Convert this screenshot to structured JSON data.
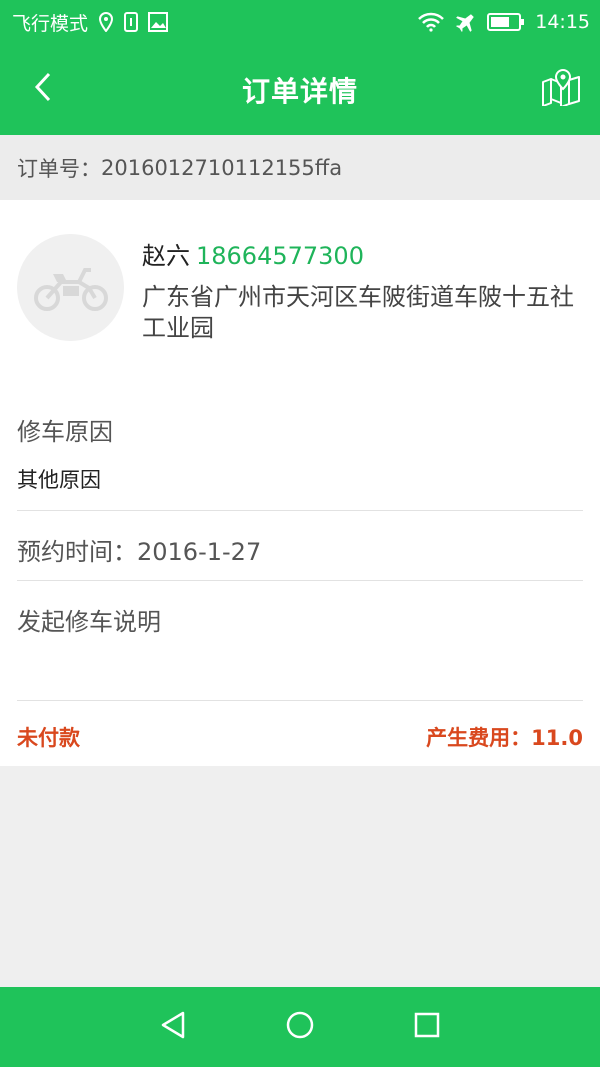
{
  "status_bar": {
    "carrier": "飞行模式",
    "time": "14:15",
    "icons": [
      "location-icon",
      "sim-icon",
      "image-icon",
      "wifi-icon",
      "airplane-icon",
      "battery-icon"
    ]
  },
  "app_bar": {
    "title": "订单详情",
    "back_icon": "chevron-left-icon",
    "map_icon": "map-location-icon"
  },
  "order": {
    "number_label": "订单号：",
    "number": "2016012710112155ffa"
  },
  "customer": {
    "name": "赵六",
    "phone": "18664577300",
    "address": "广东省广州市天河区车陂街道车陂十五社工业园",
    "avatar_icon": "motorcycle-icon"
  },
  "details": {
    "reason_label": "修车原因",
    "reason_value": "其他原因",
    "appointment_label": "预约时间：",
    "appointment_value": "2016-1-27",
    "description_label": "发起修车说明"
  },
  "payment": {
    "status": "未付款",
    "fee_label": "产生费用：",
    "fee_value": "11.0"
  },
  "colors": {
    "accent": "#1fc35a",
    "phone": "#1fb45a",
    "warning": "#d9481e",
    "background": "#efefef"
  }
}
